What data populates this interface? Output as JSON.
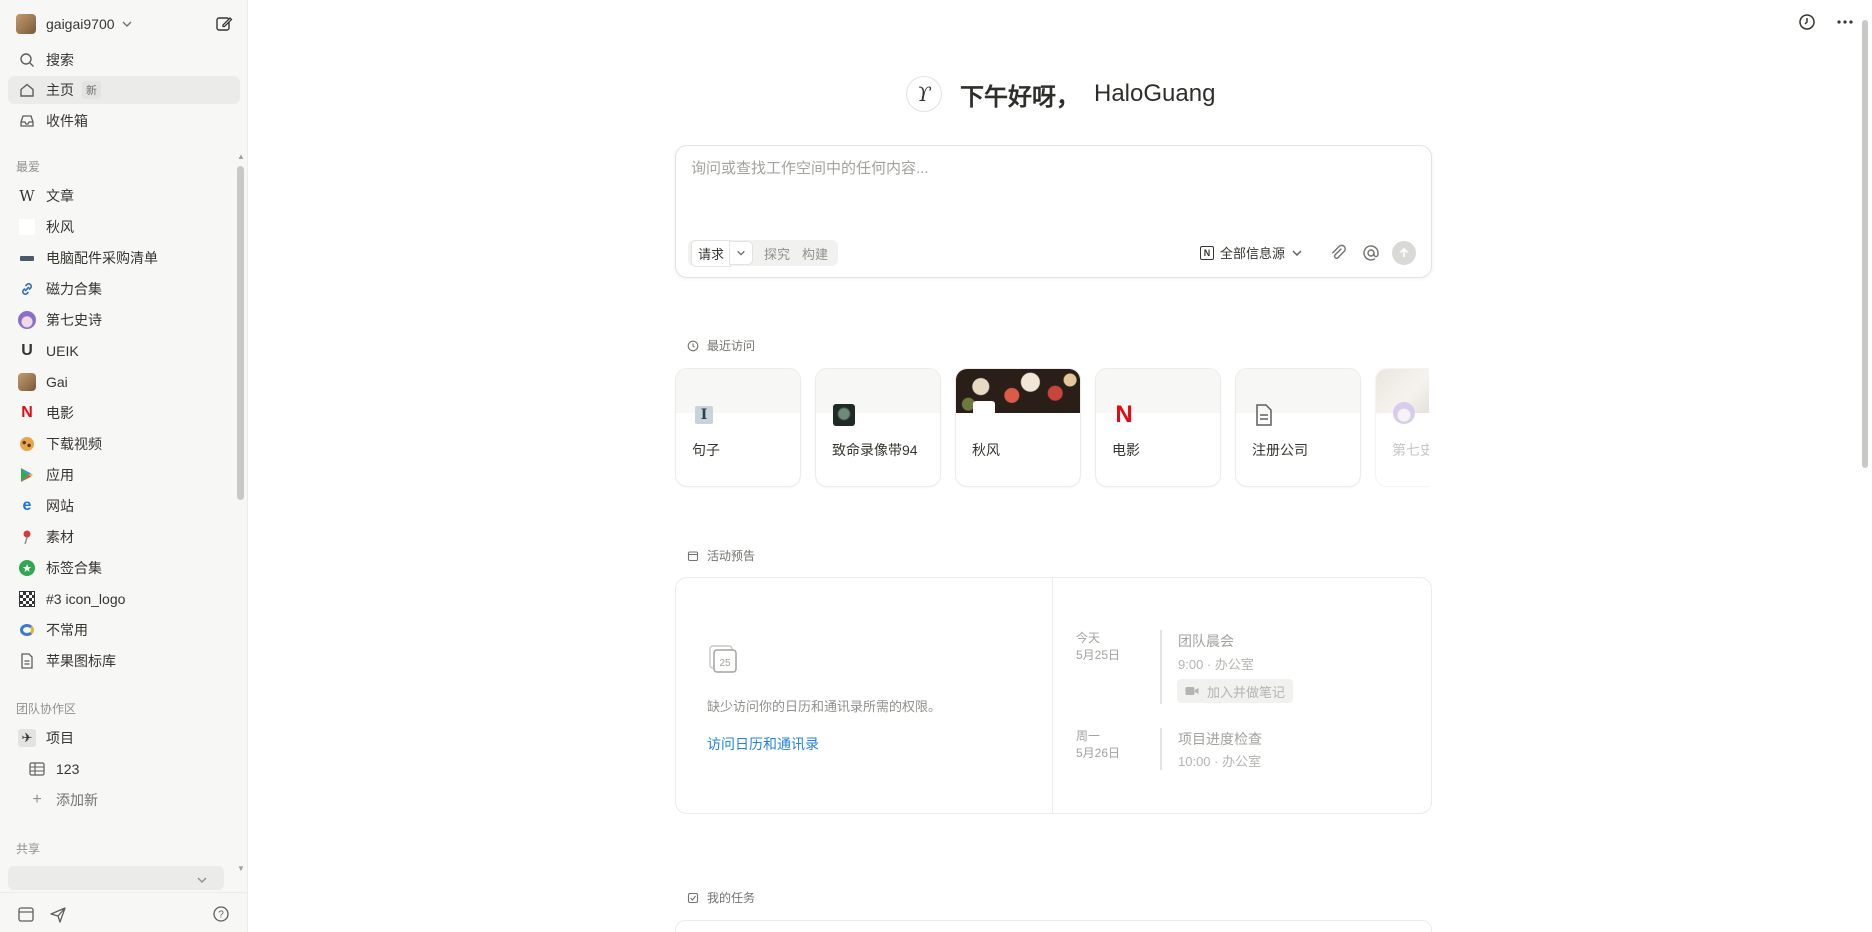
{
  "sidebar": {
    "workspace": "gaigai9700",
    "nav": [
      {
        "label": "搜索"
      },
      {
        "label": "主页",
        "badge": "新"
      },
      {
        "label": "收件箱"
      }
    ],
    "favorites_title": "最爱",
    "favorites": [
      {
        "label": "文章",
        "icon": "W"
      },
      {
        "label": "秋风",
        "icon": ""
      },
      {
        "label": "电脑配件采购清单",
        "icon": "keyboard-icon"
      },
      {
        "label": "磁力合集",
        "icon": "link-icon"
      },
      {
        "label": "第七史诗",
        "icon": "anime-avatar-icon"
      },
      {
        "label": "UEIK",
        "icon": "U"
      },
      {
        "label": "Gai",
        "icon": "avatar-icon"
      },
      {
        "label": "电影",
        "icon": "N"
      },
      {
        "label": "下载视频",
        "icon": "cookie-icon"
      },
      {
        "label": "应用",
        "icon": "play-store-icon"
      },
      {
        "label": "网站",
        "icon": "edge-icon"
      },
      {
        "label": "素材",
        "icon": "pin-icon"
      },
      {
        "label": "标签合集",
        "icon": "star-badge-icon"
      },
      {
        "label": "#3 icon_logo",
        "icon": "qr-icon"
      },
      {
        "label": "不常用",
        "icon": "swirl-icon"
      },
      {
        "label": "苹果图标库",
        "icon": "document-icon"
      }
    ],
    "team_title": "团队协作区",
    "team": [
      {
        "label": "项目"
      },
      {
        "label": "123"
      },
      {
        "label": "添加新"
      }
    ],
    "shared_title": "共享"
  },
  "main": {
    "greeting": "下午好呀，",
    "user": "HaloGuang",
    "ask": {
      "placeholder": "询问或查找工作空间中的任何内容...",
      "modes": [
        "请求",
        "探究",
        "构建"
      ],
      "source": "全部信息源"
    },
    "recent": {
      "title": "最近访问",
      "cards": [
        "句子",
        "致命录像带94",
        "秋风",
        "电影",
        "注册公司",
        "第七史"
      ]
    },
    "events": {
      "title": "活动预告",
      "message": "缺少访问你的日历和通讯录所需的权限。",
      "link": "访问日历和通讯录",
      "items": [
        {
          "day": "今天",
          "date": "5月25日",
          "title": "团队晨会",
          "detail": "9:00 · 办公室",
          "join": "加入并做笔记"
        },
        {
          "day": "周一",
          "date": "5月26日",
          "title": "项目进度检查",
          "detail": "10:00 · 办公室"
        }
      ]
    },
    "tasks": {
      "title": "我的任务"
    }
  },
  "colors": {
    "link": "#2383e2",
    "netflix": "#e50914",
    "sidebar_bg": "#f7f7f5"
  }
}
